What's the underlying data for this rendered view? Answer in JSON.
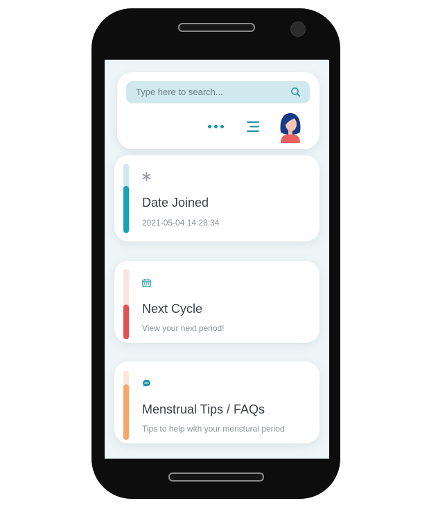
{
  "search": {
    "placeholder": "Type here to search..."
  },
  "cards": [
    {
      "title": "Date Joined",
      "subtitle": "2021-05-04 14:28:34",
      "icon": "asterisk-icon",
      "accent": "#17a2b8",
      "track": "#cfe9ee",
      "progress": 0.68
    },
    {
      "title": "Next Cycle",
      "subtitle": "View your next period!",
      "icon": "calendar-icon",
      "accent": "#e0524f",
      "track": "#fbe3e0",
      "progress": 0.5
    },
    {
      "title": "Menstrual Tips / FAQs",
      "subtitle": "Tips to help with your menstural period",
      "icon": "chat-icon",
      "accent": "#f5a76a",
      "track": "#fbe7d5",
      "progress": 0.8
    }
  ],
  "colors": {
    "teal": "#1a93a6",
    "background": "#eef5f7"
  }
}
